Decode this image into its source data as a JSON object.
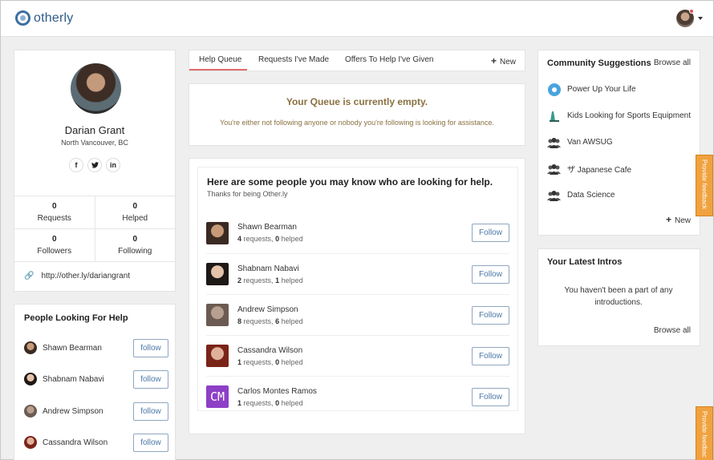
{
  "app": {
    "logo_text": "otherly"
  },
  "profile": {
    "name": "Darian Grant",
    "location": "North Vancouver, BC",
    "social": {
      "facebook": "f",
      "twitter": "t",
      "linkedin": "in"
    },
    "stats": [
      {
        "value": "0",
        "label": "Requests"
      },
      {
        "value": "0",
        "label": "Helped"
      },
      {
        "value": "0",
        "label": "Followers"
      },
      {
        "value": "0",
        "label": "Following"
      }
    ],
    "link": "http://other.ly/dariangrant"
  },
  "people_looking": {
    "title": "People Looking For Help",
    "button_label": "follow",
    "items": [
      {
        "name": "Shawn Bearman"
      },
      {
        "name": "Shabnam Nabavi"
      },
      {
        "name": "Andrew Simpson"
      },
      {
        "name": "Cassandra Wilson"
      }
    ]
  },
  "tabs": {
    "items": [
      {
        "label": "Help Queue"
      },
      {
        "label": "Requests I've Made"
      },
      {
        "label": "Offers To Help I've Given"
      }
    ],
    "active": "Help Queue",
    "new_label": "New"
  },
  "queue": {
    "title": "Your Queue is currently empty.",
    "subtitle": "You're either not following anyone or nobody you're following is looking for assistance."
  },
  "suggestions": {
    "title": "Here are some people you may know who are looking for help.",
    "subtitle": "Thanks for being Other.ly",
    "follow_label": "Follow",
    "people": [
      {
        "name": "Shawn Bearman",
        "requests": "4",
        "helped": "0"
      },
      {
        "name": "Shabnam Nabavi",
        "requests": "2",
        "helped": "1"
      },
      {
        "name": "Andrew Simpson",
        "requests": "8",
        "helped": "6"
      },
      {
        "name": "Cassandra Wilson",
        "requests": "1",
        "helped": "0"
      },
      {
        "name": "Carlos Montes Ramos",
        "requests": "1",
        "helped": "0",
        "initials": "CM"
      }
    ],
    "requests_word": "requests,",
    "helped_word": "helped"
  },
  "community": {
    "title": "Community Suggestions",
    "browse_label": "Browse all",
    "items": [
      {
        "label": "Power Up Your Life",
        "icon": "power-icon"
      },
      {
        "label": "Kids Looking for Sports Equipment",
        "icon": "sports-icon"
      },
      {
        "label": "Van AWSUG",
        "icon": "group-icon"
      },
      {
        "label": "ザ Japanese Cafe",
        "icon": "group-icon"
      },
      {
        "label": "Data Science",
        "icon": "group-icon"
      }
    ],
    "new_label": "New"
  },
  "intros": {
    "title": "Your Latest Intros",
    "body": "You haven't been a part of any introductions.",
    "browse_label": "Browse all"
  },
  "feedback": {
    "label": "Provide feedback",
    "label_short": "Provide feedbac"
  },
  "colors": {
    "accent": "#e06b6b",
    "brand": "#2d5b89",
    "queue_text": "#8a7040",
    "feedback": "#f0a23f",
    "cm_avatar": "#8d3fc6"
  }
}
